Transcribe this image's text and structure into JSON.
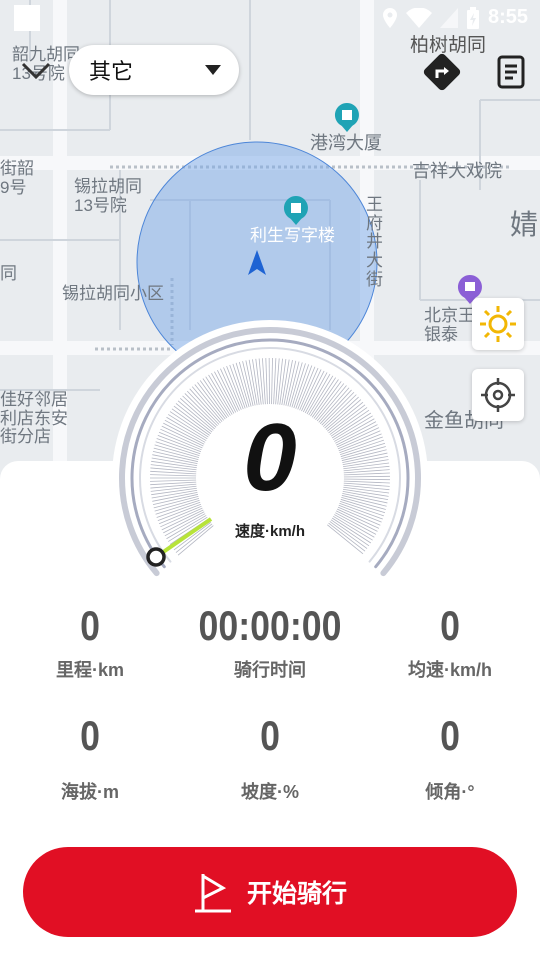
{
  "status_bar": {
    "time": "8:55"
  },
  "header": {
    "sport_select": "其它"
  },
  "map_labels": {
    "l1": "韶九胡同\n13号院",
    "l2": "柏树胡同",
    "l3": "港湾大厦",
    "l4": "吉祥大戏院",
    "l5": "锡拉胡同\n13号院",
    "l6": "利生写字楼",
    "l7": "王\n府\n井\n大\n街",
    "l8": "锡拉胡同小区",
    "l9": "北京王\n银泰",
    "l10": "佳好邻居\n利店东安\n街分店",
    "l11": "金鱼胡同",
    "l12": "街韶\n9号",
    "l13": "同",
    "l14": "婧"
  },
  "speed": {
    "value": "0",
    "unit": "速度·km/h"
  },
  "stats": [
    {
      "value": "0",
      "label": "里程·km"
    },
    {
      "value": "00:00:00",
      "label": "骑行时间"
    },
    {
      "value": "0",
      "label": "均速·km/h"
    },
    {
      "value": "0",
      "label": "海拔·m"
    },
    {
      "value": "0",
      "label": "坡度·%"
    },
    {
      "value": "0",
      "label": "倾角·°"
    }
  ],
  "start_button": {
    "label": "开始骑行"
  },
  "colors": {
    "accent": "#e10f24",
    "map_bg": "#e8ecf0",
    "location_circle": "#7aa8e8"
  }
}
